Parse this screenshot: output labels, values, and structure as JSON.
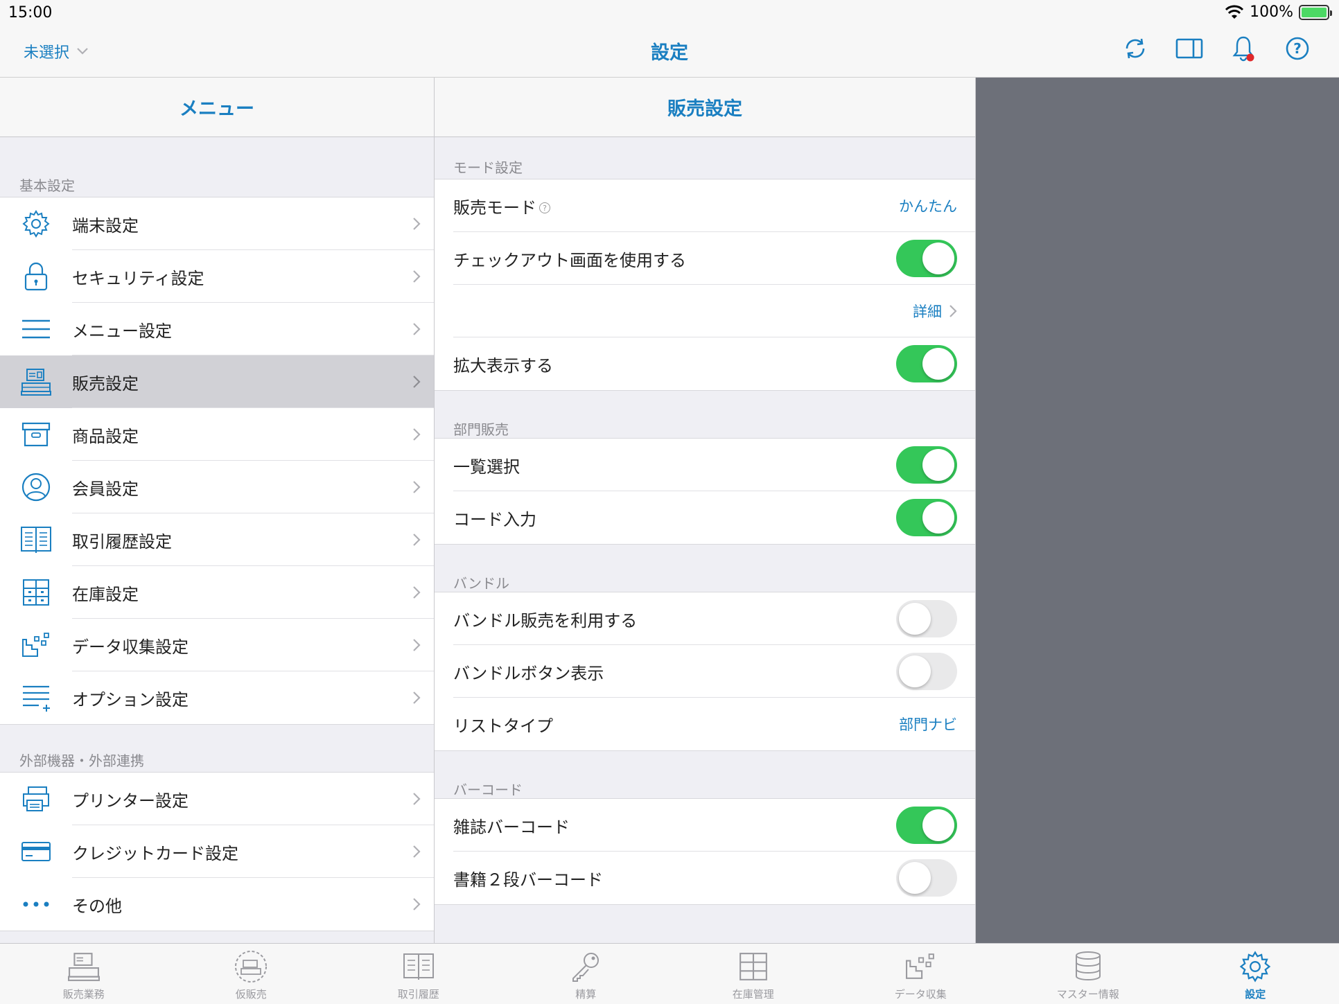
{
  "status_bar": {
    "time": "15:00",
    "battery": "100%"
  },
  "nav": {
    "left_label": "未選択",
    "title": "設定",
    "icons": [
      "sync-icon",
      "split-view-icon",
      "bell-icon",
      "help-icon"
    ]
  },
  "menu": {
    "header": "メニュー",
    "section1_label": "基本設定",
    "section1_items": [
      {
        "label": "端末設定",
        "icon": "gear-icon"
      },
      {
        "label": "セキュリティ設定",
        "icon": "lock-icon"
      },
      {
        "label": "メニュー設定",
        "icon": "menu-icon"
      },
      {
        "label": "販売設定",
        "icon": "register-icon",
        "selected": true
      },
      {
        "label": "商品設定",
        "icon": "box-icon"
      },
      {
        "label": "会員設定",
        "icon": "member-icon"
      },
      {
        "label": "取引履歴設定",
        "icon": "book-icon"
      },
      {
        "label": "在庫設定",
        "icon": "shelf-icon"
      },
      {
        "label": "データ収集設定",
        "icon": "data-icon"
      },
      {
        "label": "オプション設定",
        "icon": "option-list-icon"
      }
    ],
    "section2_label": "外部機器・外部連携",
    "section2_items": [
      {
        "label": "プリンター設定",
        "icon": "printer-icon"
      },
      {
        "label": "クレジットカード設定",
        "icon": "credit-card-icon"
      },
      {
        "label": "その他",
        "icon": "more-icon"
      }
    ]
  },
  "sales": {
    "header": "販売設定",
    "mode_section": "モード設定",
    "mode_label": "販売モード",
    "mode_value": "かんたん",
    "checkout_label": "チェックアウト画面を使用する",
    "detail_label": "詳細",
    "zoom_label": "拡大表示する",
    "dept_section": "部門販売",
    "list_select_label": "一覧選択",
    "code_input_label": "コード入力",
    "bundle_section": "バンドル",
    "bundle_use_label": "バンドル販売を利用する",
    "bundle_button_label": "バンドルボタン表示",
    "list_type_label": "リストタイプ",
    "list_type_value": "部門ナビ",
    "barcode_section": "バーコード",
    "magazine_label": "雑誌バーコード",
    "book_label": "書籍２段バーコード",
    "toggles": {
      "checkout": true,
      "zoom": true,
      "list_select": true,
      "code_input": true,
      "bundle_use": false,
      "bundle_button": false,
      "magazine": true,
      "book": false
    }
  },
  "tabs": [
    {
      "label": "販売業務",
      "icon": "register-tab-icon"
    },
    {
      "label": "仮販売",
      "icon": "temp-sale-tab-icon"
    },
    {
      "label": "取引履歴",
      "icon": "history-tab-icon"
    },
    {
      "label": "精算",
      "icon": "key-tab-icon"
    },
    {
      "label": "在庫管理",
      "icon": "stock-tab-icon"
    },
    {
      "label": "データ収集",
      "icon": "data-tab-icon"
    },
    {
      "label": "マスター情報",
      "icon": "database-tab-icon"
    },
    {
      "label": "設定",
      "icon": "gear-tab-icon",
      "active": true
    }
  ],
  "colors": {
    "accent": "#1a7fc1",
    "toggle_on": "#34c759",
    "selected_row": "#d1d1d6",
    "detail_pane": "#6d7079"
  }
}
